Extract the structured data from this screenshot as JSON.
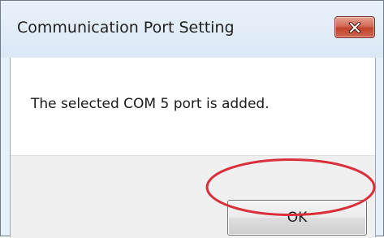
{
  "dialog": {
    "title": "Communication Port Setting",
    "message": "The selected COM 5 port is added.",
    "ok_label": "OK",
    "close_icon": "close-icon"
  },
  "colors": {
    "title_bar": "#dbe8f6",
    "close_button": "#c0432c",
    "highlight_ring": "#d9313b"
  }
}
